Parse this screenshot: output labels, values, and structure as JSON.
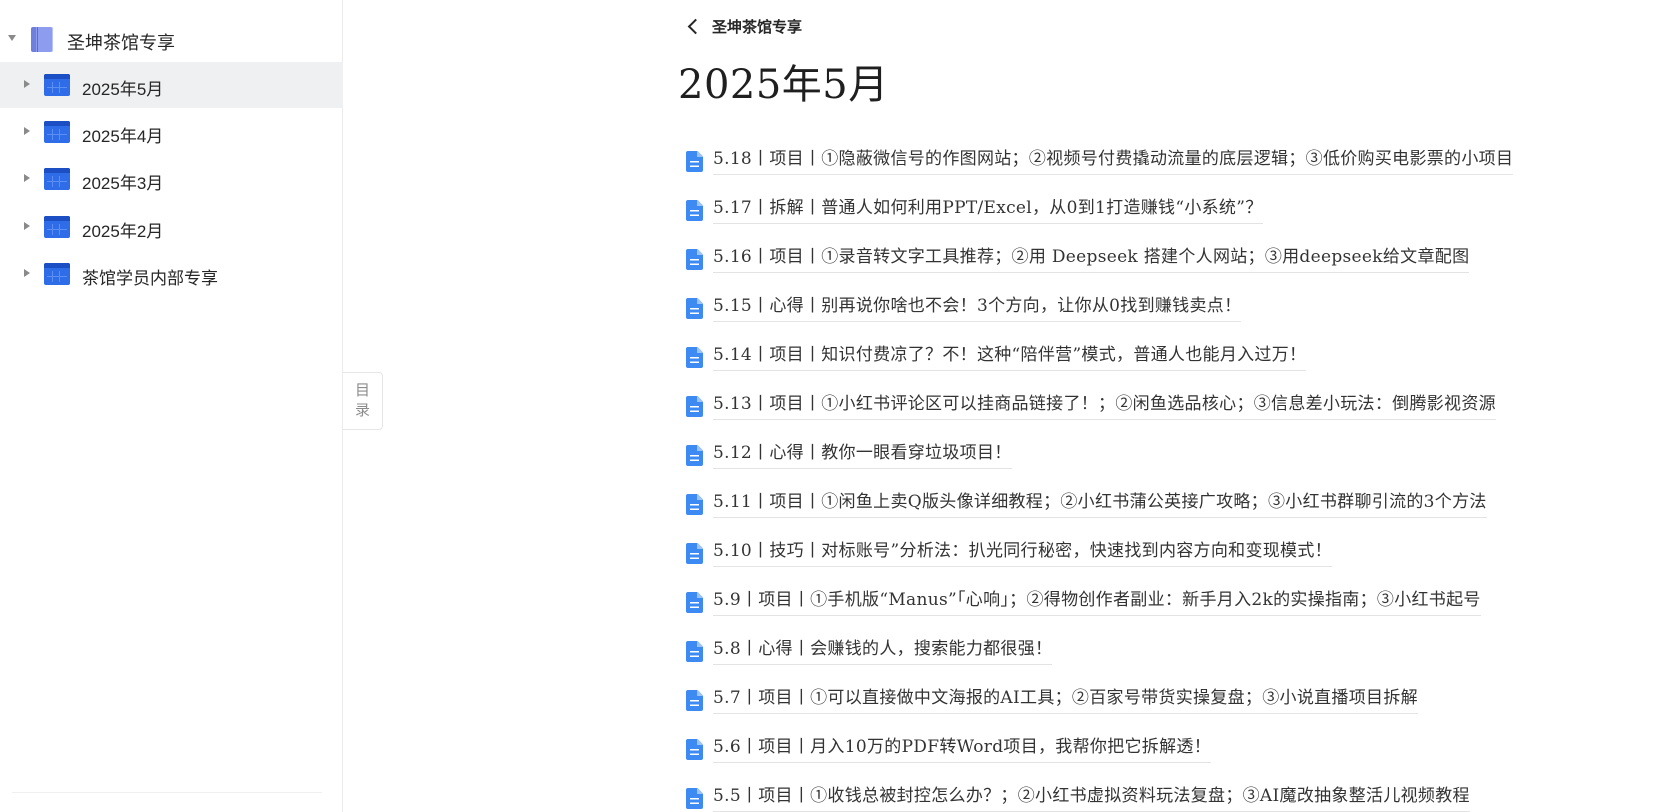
{
  "sidebar": {
    "root": {
      "label": "圣坤茶馆专享",
      "icon": "book-icon"
    },
    "items": [
      {
        "label": "2025年5月",
        "icon": "calendar-icon",
        "active": true
      },
      {
        "label": "2025年4月",
        "icon": "calendar-icon",
        "active": false
      },
      {
        "label": "2025年3月",
        "icon": "calendar-icon",
        "active": false
      },
      {
        "label": "2025年2月",
        "icon": "calendar-icon",
        "active": false
      },
      {
        "label": "茶馆学员内部专享",
        "icon": "calendar-icon",
        "active": false
      }
    ]
  },
  "toc": {
    "line1": "目",
    "line2": "录"
  },
  "header": {
    "back_label": "圣坤茶馆专享",
    "back_icon": "chevron-left-icon"
  },
  "page": {
    "title": "2025年5月"
  },
  "docs": [
    "5.18丨项目丨①隐蔽微信号的作图网站；②视频号付费撬动流量的底层逻辑；③低价购买电影票的小项目",
    "5.17丨拆解丨普通人如何利用PPT/Excel，从0到1打造赚钱“小系统”？",
    "5.16丨项目丨①录音转文字工具推荐；②用 Deepseek 搭建个人网站；③用deepseek给文章配图",
    "5.15丨心得丨别再说你啥也不会！3个方向，让你从0找到赚钱卖点！",
    "5.14丨项目丨知识付费凉了？不！这种“陪伴营”模式，普通人也能月入过万！",
    "5.13丨项目丨①小红书评论区可以挂商品链接了！；②闲鱼选品核心；③信息差小玩法：倒腾影视资源",
    "5.12丨心得丨教你一眼看穿垃圾项目！",
    "5.11丨项目丨①闲鱼上卖Q版头像详细教程；②小红书蒲公英接广攻略；③小红书群聊引流的3个方法",
    "5.10丨技巧丨对标账号”分析法：扒光同行秘密，快速找到内容方向和变现模式！",
    "5.9丨项目丨①手机版“Manus”「心响」；②得物创作者副业：新手月入2k的实操指南；③小红书起号",
    "5.8丨心得丨会赚钱的人，搜索能力都很强！",
    "5.7丨项目丨①可以直接做中文海报的AI工具；②百家号带货实操复盘；③小说直播项目拆解",
    "5.6丨项目丨月入10万的PDF转Word项目，我帮你把它拆解透！",
    "5.5丨项目丨①收钱总被封控怎么办？；②小红书虚拟资料玩法复盘；③AI魔改抽象整活儿视频教程"
  ]
}
